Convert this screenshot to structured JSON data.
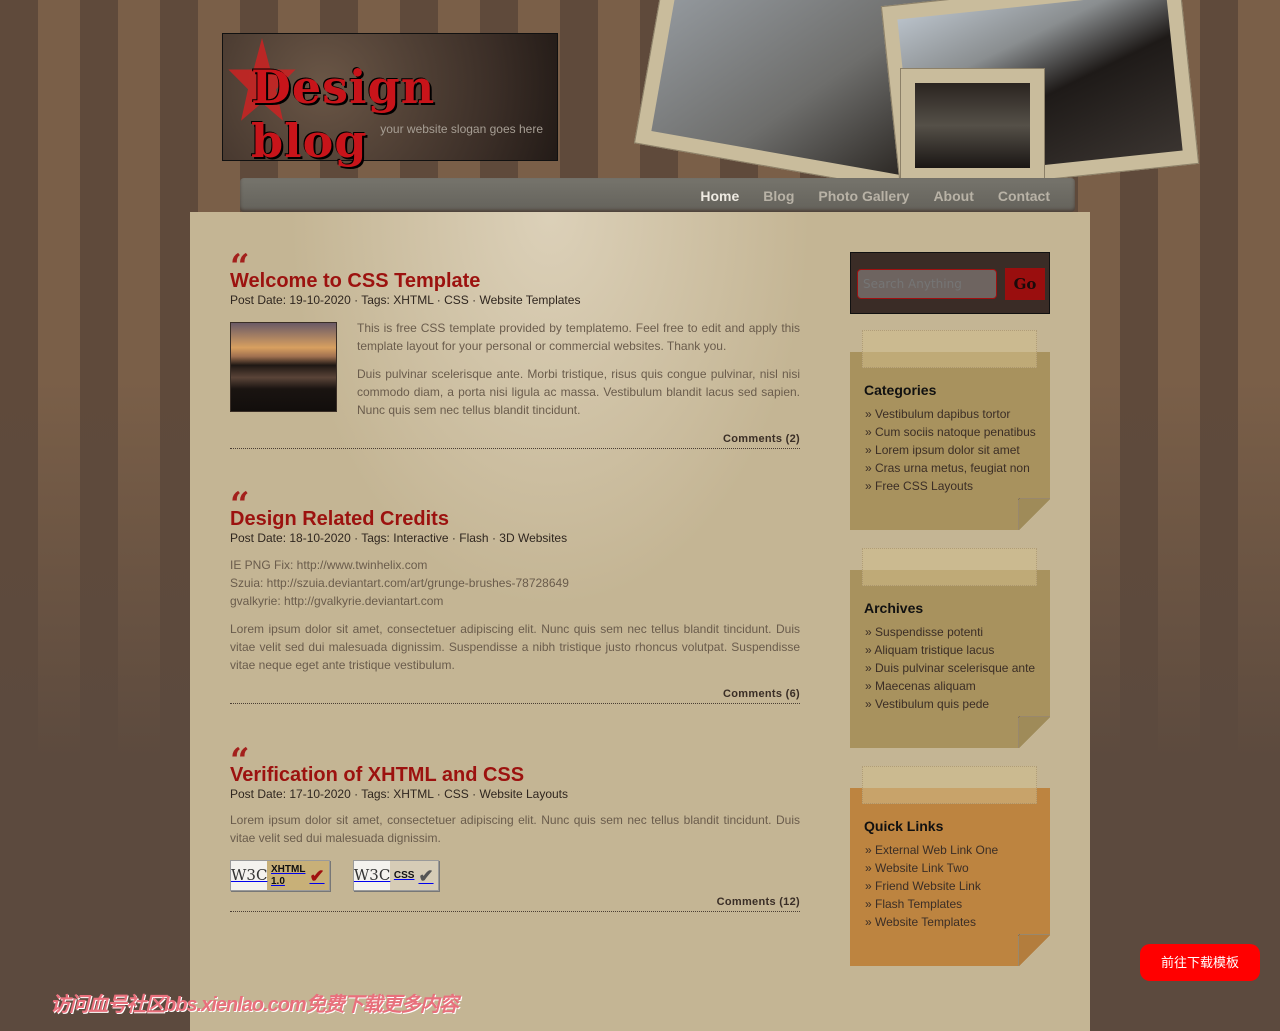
{
  "header": {
    "logo_text": "Design blog",
    "slogan": "your website slogan goes here"
  },
  "nav": [
    {
      "label": "Home",
      "active": true
    },
    {
      "label": "Blog"
    },
    {
      "label": "Photo Gallery"
    },
    {
      "label": "About"
    },
    {
      "label": "Contact"
    }
  ],
  "posts": [
    {
      "title": "Welcome to CSS Template",
      "date_label": "Post Date: 19-10-2020",
      "tags_label": "Tags:",
      "tags": [
        "XHTML",
        "CSS",
        "Website Templates"
      ],
      "paragraphs": [
        "This is free CSS template provided by templatemo. Feel free to edit and apply this template layout for your personal or commercial websites. Thank you.",
        "Duis pulvinar scelerisque ante. Morbi tristique, risus quis congue pulvinar, nisl nisi commodo diam, a porta nisi ligula ac massa. Vestibulum blandit lacus sed sapien. Nunc quis sem nec tellus blandit tincidunt."
      ],
      "comments": "Comments (2)"
    },
    {
      "title": "Design Related Credits",
      "date_label": "Post Date: 18-10-2020",
      "tags_label": "Tags:",
      "tags": [
        "Interactive",
        "Flash",
        "3D Websites"
      ],
      "credits": [
        "IE PNG Fix: http://www.twinhelix.com",
        "Szuia: http://szuia.deviantart.com/art/grunge-brushes-78728649",
        "gvalkyrie: http://gvalkyrie.deviantart.com"
      ],
      "paragraphs": [
        "Lorem ipsum dolor sit amet, consectetuer adipiscing elit. Nunc quis sem nec tellus blandit tincidunt. Duis vitae velit sed dui malesuada dignissim. Suspendisse a nibh tristique justo rhoncus volutpat. Suspendisse vitae neque eget ante tristique vestibulum."
      ],
      "comments": "Comments (6)"
    },
    {
      "title": "Verification of XHTML and CSS",
      "date_label": "Post Date: 17-10-2020",
      "tags_label": "Tags:",
      "tags": [
        "XHTML",
        "CSS",
        "Website Layouts"
      ],
      "paragraphs": [
        "Lorem ipsum dolor sit amet, consectetuer adipiscing elit. Nunc quis sem nec tellus blandit tincidunt. Duis vitae velit sed dui malesuada dignissim."
      ],
      "badges": [
        {
          "logo": "W3C",
          "label1": "XHTML",
          "label2": "1.0",
          "check_color": "#a01010"
        },
        {
          "logo": "W3C",
          "label1": "CSS",
          "check_color": "#555555"
        }
      ],
      "comments": "Comments (12)"
    }
  ],
  "search": {
    "placeholder": "Search Anything",
    "button": "Go"
  },
  "sidebar": [
    {
      "title": "Categories",
      "color": "#a8925e",
      "items": [
        "Vestibulum dapibus tortor",
        "Cum sociis natoque penatibus",
        "Lorem ipsum dolor sit amet",
        "Cras urna metus, feugiat non",
        "Free CSS Layouts"
      ]
    },
    {
      "title": "Archives",
      "color": "#a8925e",
      "items": [
        "Suspendisse potenti",
        "Aliquam tristique lacus",
        "Duis pulvinar scelerisque ante",
        "Maecenas aliquam",
        "Vestibulum quis pede"
      ]
    },
    {
      "title": "Quick Links",
      "color": "#bd8440",
      "items": [
        "External Web Link One",
        "Website Link Two",
        "Friend Website Link",
        "Flash Templates",
        "Website Templates"
      ]
    }
  ],
  "download_button": "前往下载模板",
  "watermark": "访问血号社区bbs.xienlao.com免费下载更多内容",
  "colors": {
    "title_red": "#9c120f",
    "panel": "#c4b594",
    "background": "#5c4a3e"
  }
}
